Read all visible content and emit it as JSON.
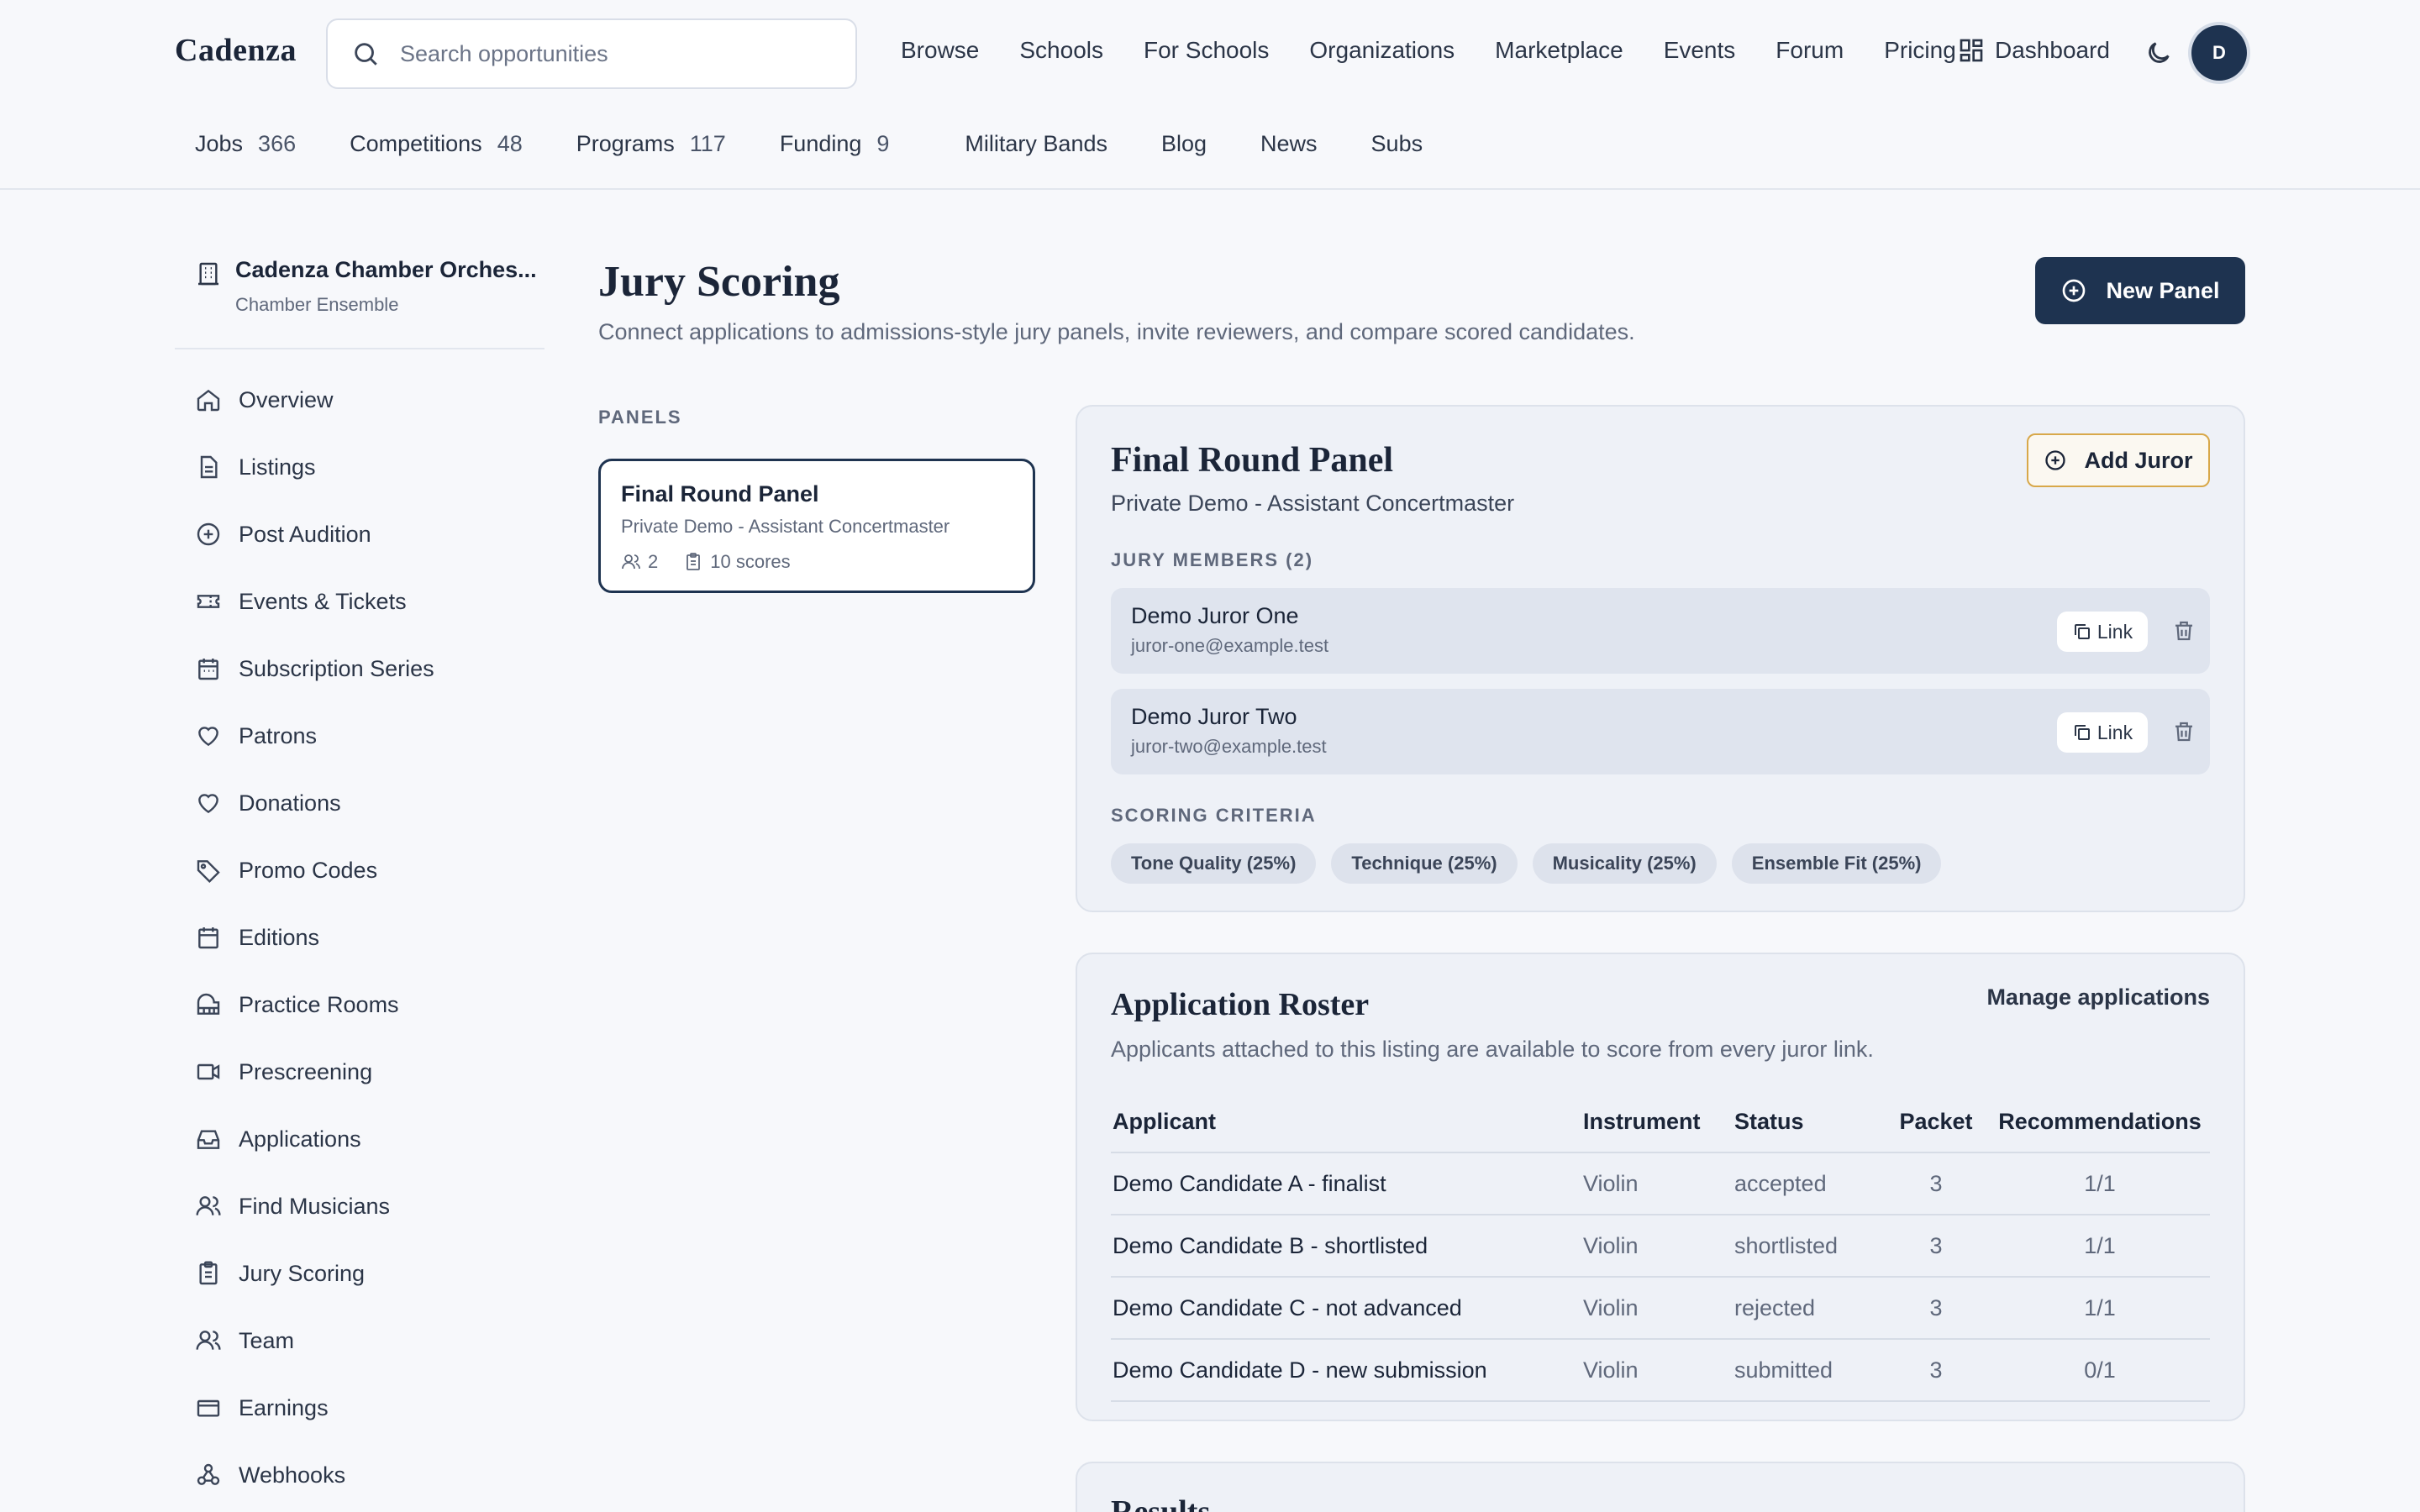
{
  "header": {
    "brand": "Cadenza",
    "search_placeholder": "Search opportunities",
    "nav": [
      "Browse",
      "Schools",
      "For Schools",
      "Organizations",
      "Marketplace",
      "Events",
      "Forum",
      "Pricing"
    ],
    "dashboard": "Dashboard",
    "avatar_initial": "D",
    "subnav": [
      {
        "label": "Jobs",
        "count": "366"
      },
      {
        "label": "Competitions",
        "count": "48"
      },
      {
        "label": "Programs",
        "count": "117"
      },
      {
        "label": "Funding",
        "count": "9"
      },
      {
        "label": "Military Bands",
        "count": ""
      },
      {
        "label": "Blog",
        "count": ""
      },
      {
        "label": "News",
        "count": ""
      },
      {
        "label": "Subs",
        "count": ""
      }
    ]
  },
  "sidebar": {
    "org_name": "Cadenza Chamber Orches...",
    "org_type": "Chamber Ensemble",
    "items": [
      {
        "label": "Overview",
        "icon": "home-icon"
      },
      {
        "label": "Listings",
        "icon": "document-icon"
      },
      {
        "label": "Post Audition",
        "icon": "plus-circle-icon"
      },
      {
        "label": "Events & Tickets",
        "icon": "ticket-icon"
      },
      {
        "label": "Subscription Series",
        "icon": "calendar-icon"
      },
      {
        "label": "Patrons",
        "icon": "heart-icon"
      },
      {
        "label": "Donations",
        "icon": "heart-icon"
      },
      {
        "label": "Promo Codes",
        "icon": "tag-icon"
      },
      {
        "label": "Editions",
        "icon": "calendar-icon"
      },
      {
        "label": "Practice Rooms",
        "icon": "piano-icon"
      },
      {
        "label": "Prescreening",
        "icon": "video-icon"
      },
      {
        "label": "Applications",
        "icon": "inbox-icon"
      },
      {
        "label": "Find Musicians",
        "icon": "users-icon"
      },
      {
        "label": "Jury Scoring",
        "icon": "clipboard-icon"
      },
      {
        "label": "Team",
        "icon": "users-icon"
      },
      {
        "label": "Earnings",
        "icon": "card-icon"
      },
      {
        "label": "Webhooks",
        "icon": "webhook-icon"
      }
    ]
  },
  "main": {
    "title": "Jury Scoring",
    "subtitle": "Connect applications to admissions-style jury panels, invite reviewers, and compare scored candidates.",
    "new_panel": "New Panel",
    "panels_label": "PANELS",
    "panel_card": {
      "title": "Final Round Panel",
      "subtitle": "Private Demo - Assistant Concertmaster",
      "jurors": "2",
      "scores": "10 scores"
    },
    "panel_detail": {
      "title": "Final Round Panel",
      "subtitle": "Private Demo - Assistant Concertmaster",
      "add_juror": "Add Juror",
      "members_label": "JURY MEMBERS (2)",
      "members": [
        {
          "name": "Demo Juror One",
          "email": "juror-one@example.test"
        },
        {
          "name": "Demo Juror Two",
          "email": "juror-two@example.test"
        }
      ],
      "link_label": "Link",
      "criteria_label": "SCORING CRITERIA",
      "criteria": [
        "Tone Quality (25%)",
        "Technique (25%)",
        "Musicality (25%)",
        "Ensemble Fit (25%)"
      ]
    },
    "roster": {
      "title": "Application Roster",
      "manage": "Manage applications",
      "subtitle": "Applicants attached to this listing are available to score from every juror link.",
      "columns": [
        "Applicant",
        "Instrument",
        "Status",
        "Packet",
        "Recommendations"
      ],
      "rows": [
        {
          "applicant": "Demo Candidate A - finalist",
          "instrument": "Violin",
          "status": "accepted",
          "packet": "3",
          "recs": "1/1"
        },
        {
          "applicant": "Demo Candidate B - shortlisted",
          "instrument": "Violin",
          "status": "shortlisted",
          "packet": "3",
          "recs": "1/1"
        },
        {
          "applicant": "Demo Candidate C - not advanced",
          "instrument": "Violin",
          "status": "rejected",
          "packet": "3",
          "recs": "1/1"
        },
        {
          "applicant": "Demo Candidate D - new submission",
          "instrument": "Violin",
          "status": "submitted",
          "packet": "3",
          "recs": "0/1"
        }
      ]
    },
    "results_title": "Results"
  }
}
